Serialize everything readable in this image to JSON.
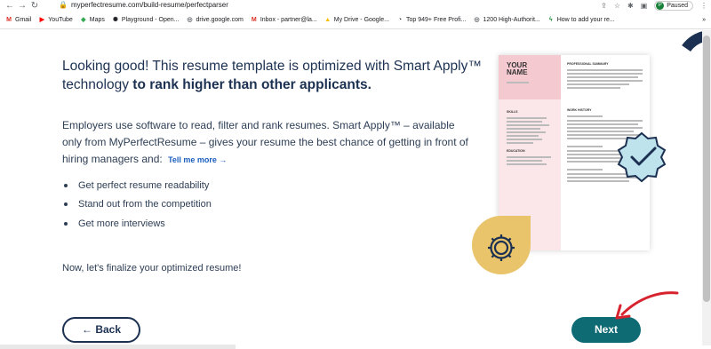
{
  "browser": {
    "url": "myperfectresume.com/build-resume/perfectparser",
    "profile_status": "Paused",
    "profile_initial": "P",
    "bookmarks": [
      {
        "label": "Gmail",
        "icon": "gmail-icon",
        "color": "#d93025",
        "glyph": "M"
      },
      {
        "label": "YouTube",
        "icon": "youtube-icon",
        "color": "#ff0000",
        "glyph": "▶"
      },
      {
        "label": "Maps",
        "icon": "maps-icon",
        "color": "#34a853",
        "glyph": "◆"
      },
      {
        "label": "Playground - Open...",
        "icon": "openai-icon",
        "color": "#202124",
        "glyph": "✺"
      },
      {
        "label": "drive.google.com",
        "icon": "globe-icon",
        "color": "#5f6368",
        "glyph": "◎"
      },
      {
        "label": "Inbox - partner@la...",
        "icon": "gmail-icon",
        "color": "#d93025",
        "glyph": "M"
      },
      {
        "label": "My Drive - Google...",
        "icon": "drive-icon",
        "color": "#fbbc04",
        "glyph": "▲"
      },
      {
        "label": "Top 949+ Free Profi...",
        "icon": "site-icon",
        "color": "#202124",
        "glyph": "◔"
      },
      {
        "label": "1200 High-Authorit...",
        "icon": "globe-icon",
        "color": "#5f6368",
        "glyph": "◎"
      },
      {
        "label": "How to add your re...",
        "icon": "bolt-icon",
        "color": "#1e8e3e",
        "glyph": "ϟ"
      }
    ],
    "more_bookmarks": "»"
  },
  "main": {
    "heading_normal": "Looking good! This resume template is optimized with Smart Apply™ technology ",
    "heading_bold": "to rank higher than other applicants.",
    "description": "Employers use software to read, filter and rank resumes. Smart Apply™ – available only from MyPerfectResume – gives your resume the best chance of getting in front of hiring managers and:",
    "tell_more": "Tell me more →",
    "benefits": [
      "Get perfect resume readability",
      "Stand out from the competition",
      "Get more interviews"
    ],
    "finalize": "Now, let's finalize your optimized resume!"
  },
  "actions": {
    "back_label": "← Back",
    "next_label": "Next"
  },
  "resume_preview": {
    "name_line1": "YOUR",
    "name_line2": "NAME",
    "summary_title": "PROFESSIONAL SUMMARY",
    "skills_title": "SKILLS",
    "education_title": "EDUCATION",
    "history_title": "WORK HISTORY"
  },
  "colors": {
    "navy": "#1c3152",
    "teal": "#0e6b74",
    "badge_gold": "#e9c46a",
    "badge_blue": "#bfe3ec",
    "arrow_red": "#d6232e"
  }
}
